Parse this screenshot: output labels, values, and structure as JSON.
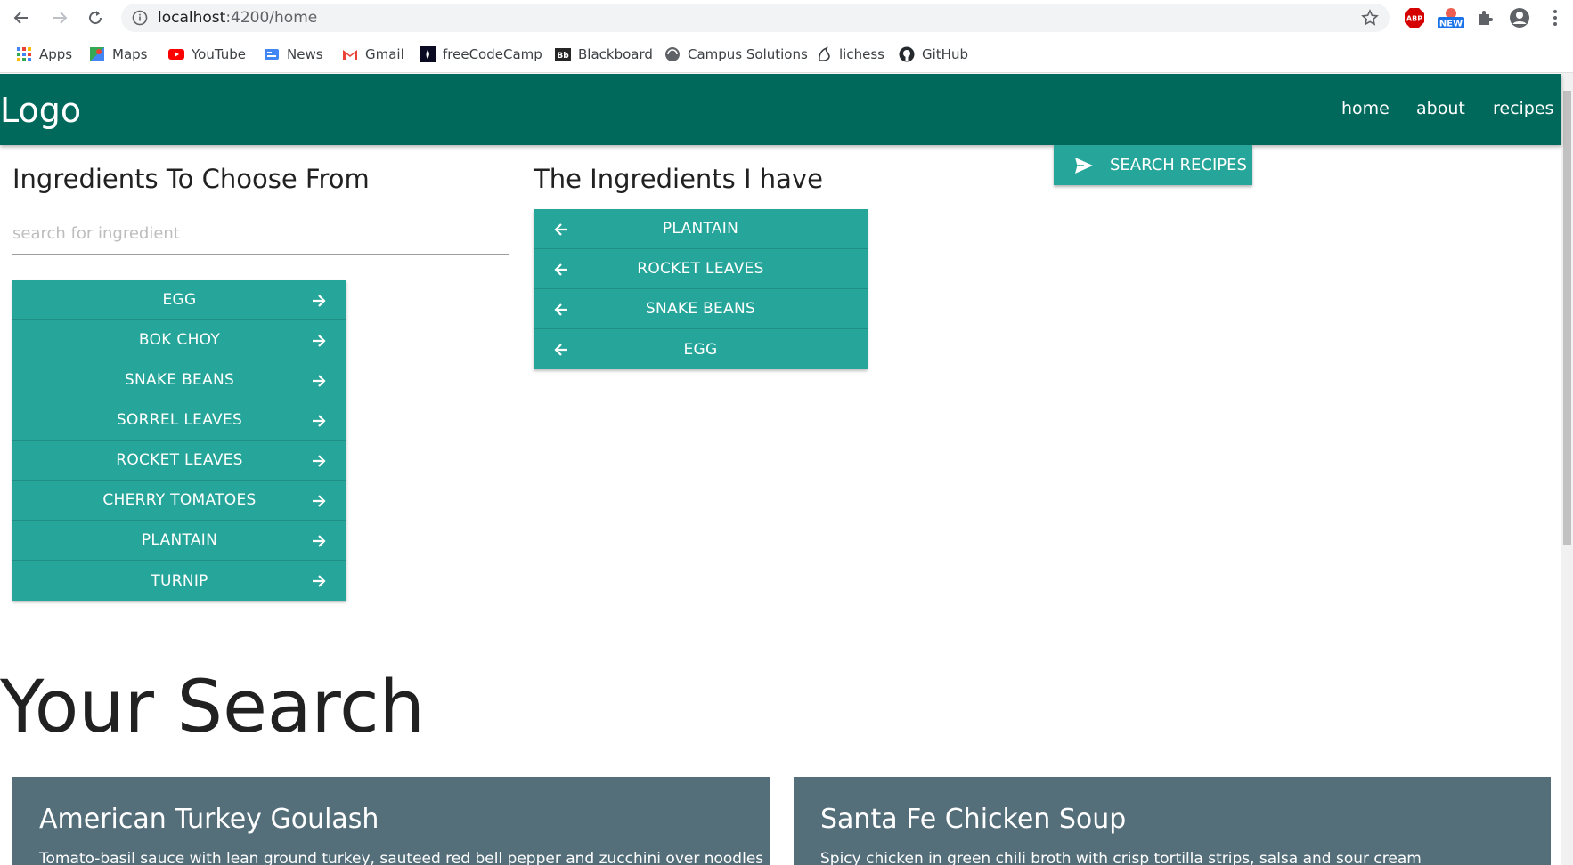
{
  "browser": {
    "url_host": "localhost",
    "url_path": ":4200/home",
    "bookmarks": [
      {
        "label": "Apps",
        "icon": "apps-grid-icon"
      },
      {
        "label": "Maps",
        "icon": "maps-icon"
      },
      {
        "label": "YouTube",
        "icon": "youtube-icon"
      },
      {
        "label": "News",
        "icon": "news-icon"
      },
      {
        "label": "Gmail",
        "icon": "gmail-icon"
      },
      {
        "label": "freeCodeCamp",
        "icon": "freecodecamp-icon"
      },
      {
        "label": "Blackboard",
        "icon": "blackboard-icon"
      },
      {
        "label": "Campus Solutions",
        "icon": "campus-solutions-icon"
      },
      {
        "label": "lichess",
        "icon": "lichess-icon"
      },
      {
        "label": "GitHub",
        "icon": "github-icon"
      }
    ],
    "extensions": {
      "abp_label": "ABP",
      "new_badge": "NEW"
    }
  },
  "header": {
    "logo": "Logo",
    "nav": [
      "home",
      "about",
      "recipes"
    ]
  },
  "choose": {
    "title": "Ingredients To Choose From",
    "search_placeholder": "search for ingredient",
    "items": [
      "EGG",
      "BOK CHOY",
      "SNAKE BEANS",
      "SORREL LEAVES",
      "ROCKET LEAVES",
      "CHERRY TOMATOES",
      "PLANTAIN",
      "TURNIP"
    ]
  },
  "have": {
    "title": "The Ingredients I have",
    "items": [
      "PLANTAIN",
      "ROCKET LEAVES",
      "SNAKE BEANS",
      "EGG"
    ]
  },
  "search_button": {
    "label": "SEARCH RECIPES"
  },
  "results": {
    "title": "Your Search",
    "cards": [
      {
        "title": "American Turkey Goulash",
        "description": "Tomato-basil sauce with lean ground turkey, sauteed red bell pepper and zucchini over noodles"
      },
      {
        "title": "Santa Fe Chicken Soup",
        "description": "Spicy chicken in green chili broth with crisp tortilla strips, salsa and sour cream"
      }
    ]
  },
  "colors": {
    "header": "#00695c",
    "chip": "#26a69a",
    "card": "#546e7a"
  }
}
